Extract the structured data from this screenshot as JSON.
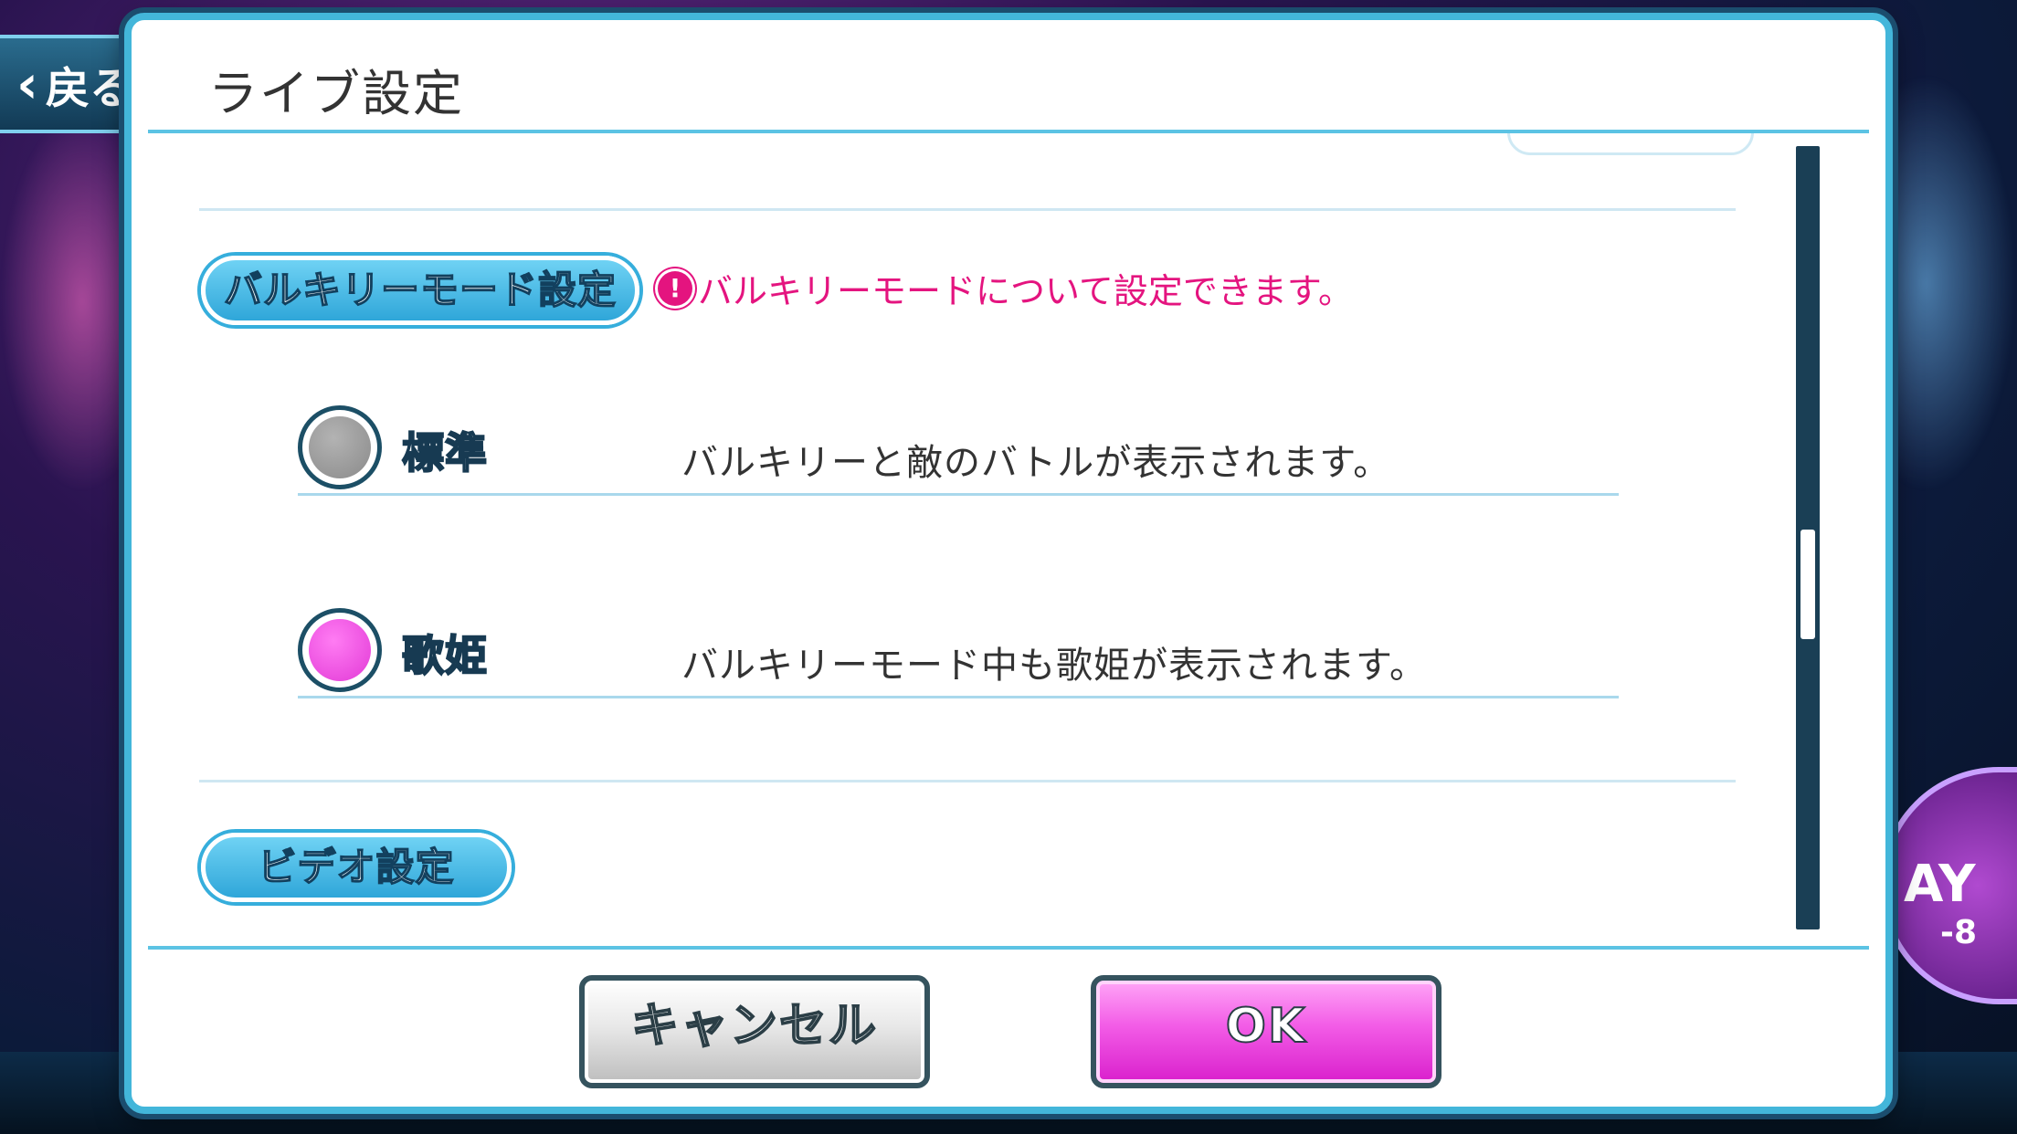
{
  "background": {
    "back_label": "戻る",
    "play_badge": "AY",
    "play_badge_sub": "-8"
  },
  "dialog": {
    "title": "ライブ設定"
  },
  "valkyrie_section": {
    "label": "バルキリーモード設定",
    "note": "バルキリーモードについて設定できます。",
    "options": [
      {
        "label": "標準",
        "description": "バルキリーと敵のバトルが表示されます。",
        "selected": false
      },
      {
        "label": "歌姫",
        "description": "バルキリーモード中も歌姫が表示されます。",
        "selected": true
      }
    ]
  },
  "video_section": {
    "label": "ビデオ設定"
  },
  "buttons": {
    "cancel_label": "キャンセル",
    "ok_label": "OK"
  },
  "colors": {
    "accent": "#43b6da",
    "selected": "#e23ad6",
    "note": "#e4147f"
  }
}
